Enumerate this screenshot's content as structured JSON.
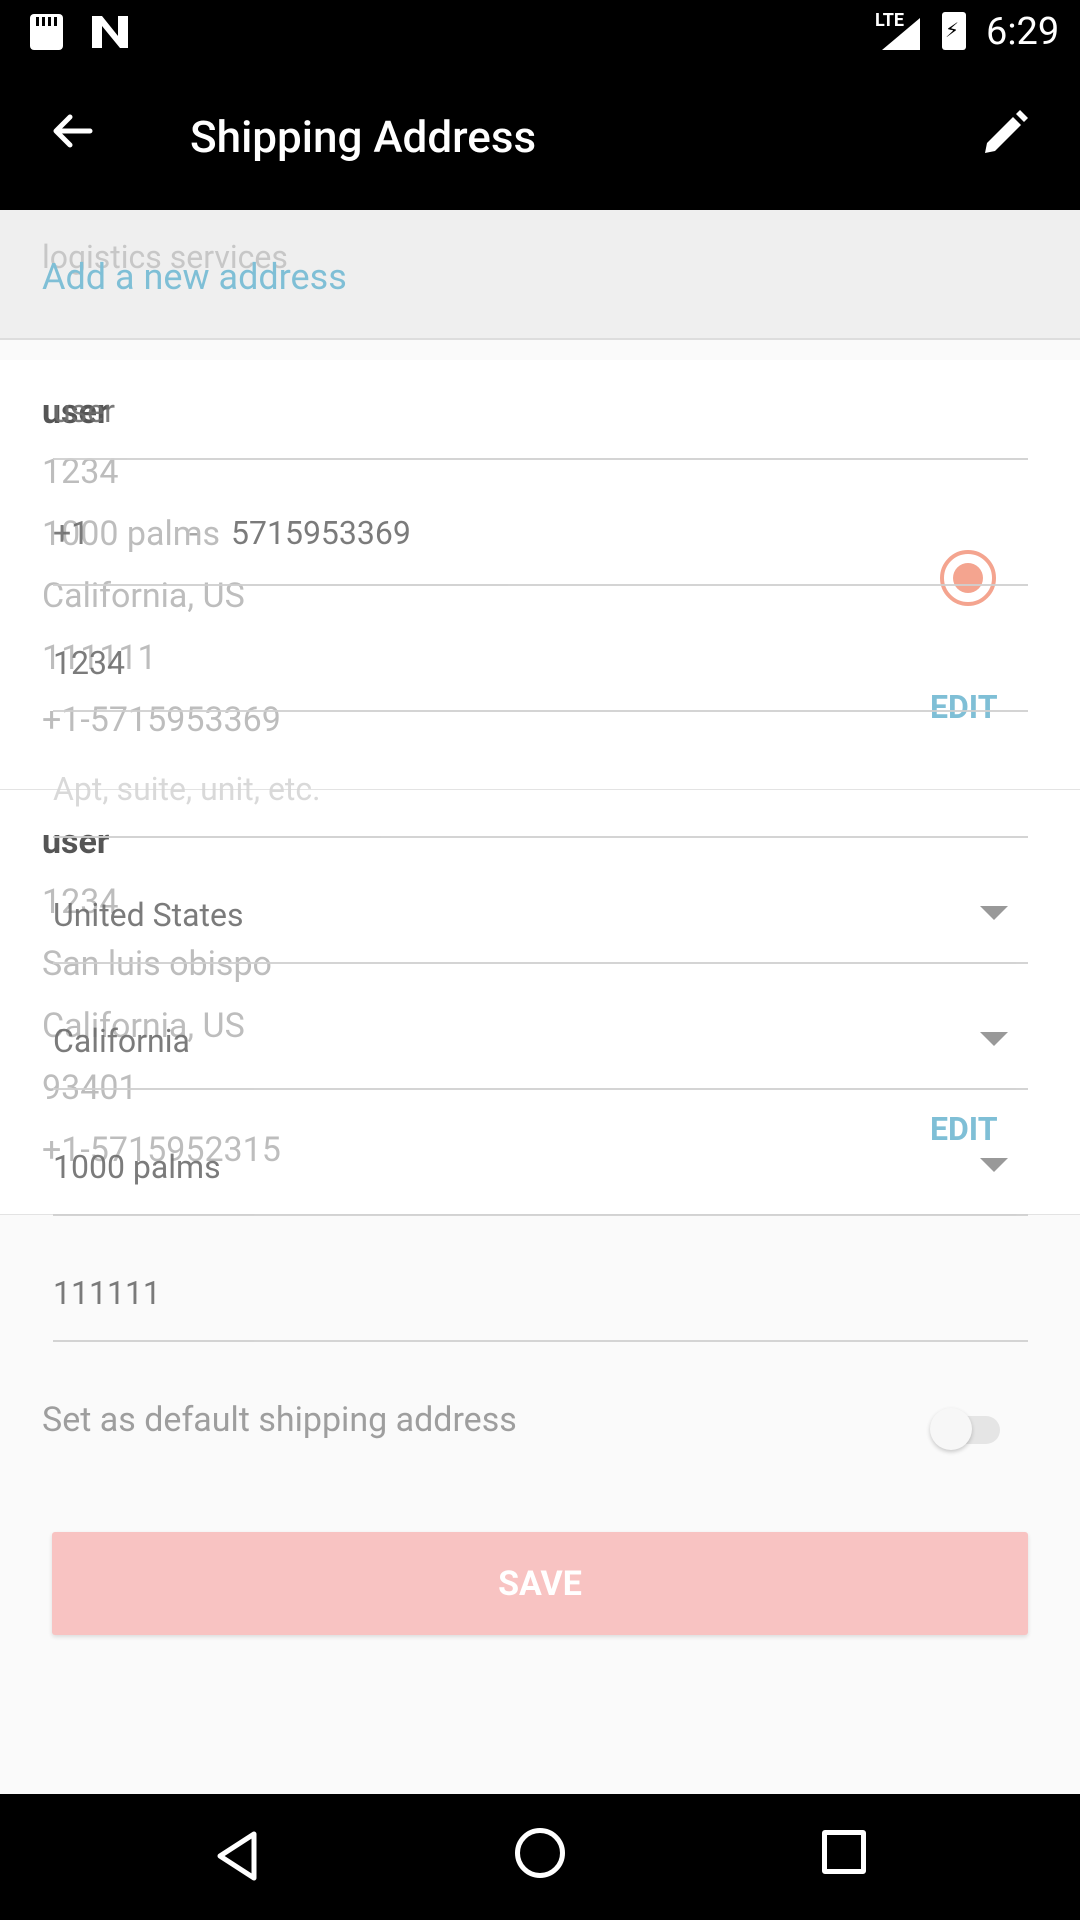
{
  "status_bar": {
    "network": "LTE",
    "time": "6:29"
  },
  "app_bar": {
    "title": "Shipping Address"
  },
  "list": {
    "logistics_text": "logistics services",
    "add_new": "Add a new address",
    "addresses": [
      {
        "name": "user",
        "lines": [
          "1234",
          "1000 palms",
          "California, US",
          "111111",
          "+1-5715953369"
        ],
        "edit": "EDIT",
        "selected": true
      },
      {
        "name": "user",
        "lines": [
          "1234",
          "San luis obispo",
          "California, US",
          "93401",
          "+1-5715952315"
        ],
        "edit": "EDIT",
        "selected": false
      }
    ]
  },
  "form": {
    "name": {
      "value": "user"
    },
    "phone": {
      "country_code": "+1",
      "dash": "-",
      "number": "5715953369"
    },
    "address_line1": {
      "value": "1234"
    },
    "address_line2": {
      "placeholder": "Apt, suite, unit, etc."
    },
    "country": {
      "value": "United States"
    },
    "state": {
      "value": "California"
    },
    "city": {
      "value": "1000 palms"
    },
    "zip": {
      "value": "111111"
    },
    "default_label": "Set as default shipping address",
    "default_on": false,
    "save_label": "SAVE"
  },
  "colors": {
    "accent_blue": "#7fbfd6",
    "save_button": "#f8c3c2",
    "radio_selected": "#f4a48f"
  },
  "icons": {
    "back": "arrow-back-icon",
    "edit": "pencil-icon",
    "nav_back": "triangle-back-icon",
    "nav_home": "circle-home-icon",
    "nav_recent": "square-recent-icon"
  }
}
